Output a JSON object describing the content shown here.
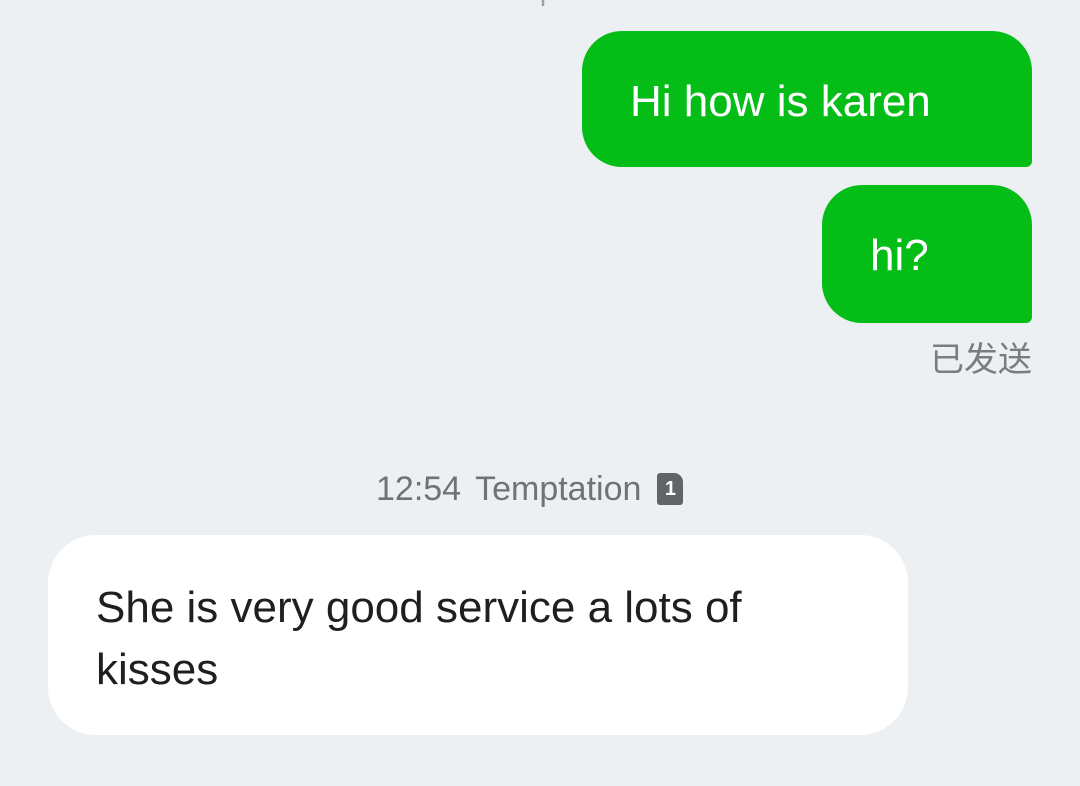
{
  "conversation": {
    "outgoing": [
      {
        "text": "Hi how is karen"
      },
      {
        "text": "hi?"
      }
    ],
    "sent_status": "已发送",
    "incoming_meta": {
      "time": "12:54",
      "sender": "Temptation",
      "sim_slot": "1"
    },
    "incoming": [
      {
        "text": "She is very good service a lots of kisses"
      }
    ]
  },
  "colors": {
    "background": "#edf0f2",
    "outgoing_bubble": "#04bd17",
    "incoming_bubble": "#ffffff",
    "meta_text": "#6f7377"
  }
}
